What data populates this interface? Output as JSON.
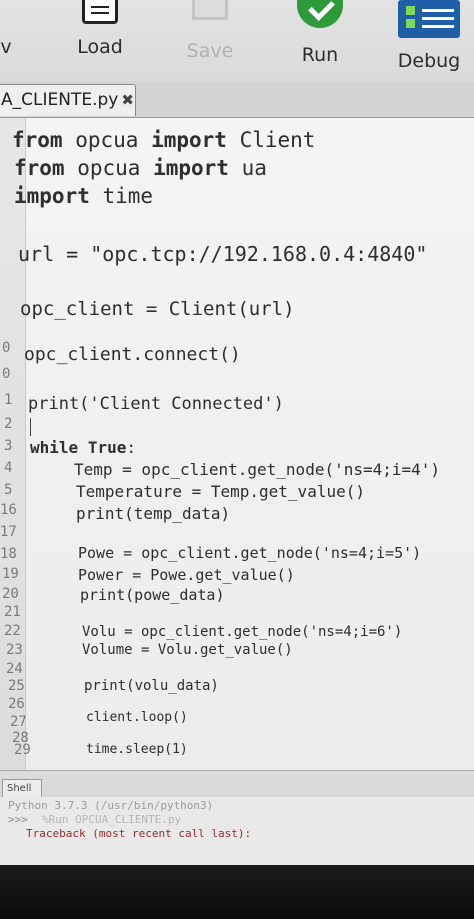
{
  "toolbar": {
    "stub_label": "v",
    "load_label": "Load",
    "save_label": "Save",
    "run_label": "Run",
    "debug_label": "Debug"
  },
  "tab": {
    "title": "A_CLIENTE.py",
    "close_glyph": "✖"
  },
  "editor": {
    "line_numbers": [
      "",
      "",
      "",
      "",
      "",
      "",
      "",
      "",
      "0",
      "0",
      "1",
      "2",
      "3",
      "4",
      "5",
      "16",
      "17",
      "18",
      "19",
      "20",
      "21",
      "22",
      "23",
      "24",
      "25",
      "26",
      "27",
      "28",
      "29"
    ],
    "code": [
      "from opcua import Client",
      "from opcua import ua",
      "import time",
      "url = \"opc.tcp://192.168.0.4:4840\"",
      "opc_client = Client(url)",
      "opc_client.connect()",
      "print('Client Connected')",
      "while True:",
      "Temp = opc_client.get_node('ns=4;i=4')",
      "Temperature = Temp.get_value()",
      "print(temp_data)",
      "Powe = opc_client.get_node('ns=4;i=5')",
      "Power = Powe.get_value()",
      "print(powe_data)",
      "Volu = opc_client.get_node('ns=4;i=6')",
      "Volume = Volu.get_value()",
      "print(volu_data)",
      "client.loop()",
      "time.sleep(1)"
    ]
  },
  "shell": {
    "tab_label": "Shell",
    "version_line": "Python 3.7.3 (/usr/bin/python3)",
    "prompt": ">>>",
    "run_command": "%Run OPCUA_CLIENTE.py",
    "traceback": "Traceback (most recent call last):"
  },
  "colors": {
    "run_green": "#2e9b3a",
    "debug_blue": "#1f5fa8",
    "error_red": "#9c2a2a"
  }
}
